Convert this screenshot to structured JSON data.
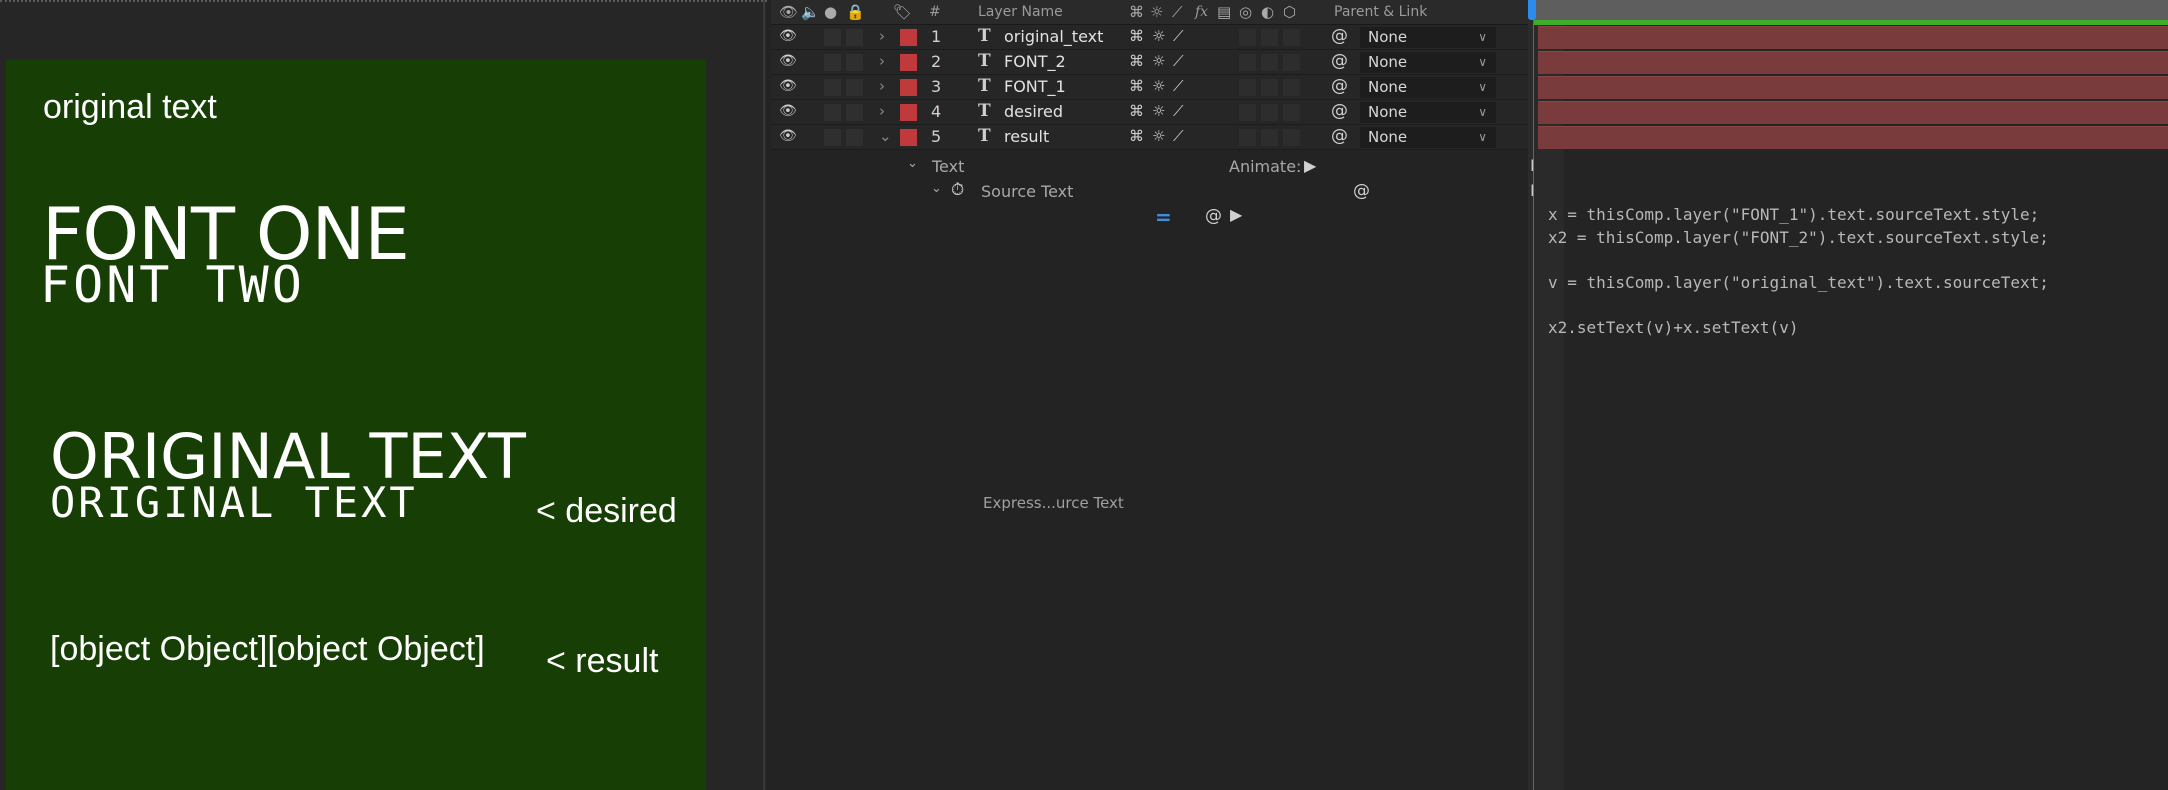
{
  "comp": {
    "original_text": "original text",
    "font_one": "FONT ONE",
    "font_two": "FONT TWO",
    "original_big": "ORIGINAL TEXT",
    "original_mono": "ORIGINAL TEXT",
    "desired_label": "< desired",
    "result_text": "[object Object][object Object]",
    "result_label": "< result",
    "bg_color": "#173e05"
  },
  "layers_header": {
    "num": "#",
    "layer_name": "Layer Name",
    "fx": "fx",
    "parent_link": "Parent & Link"
  },
  "layers": [
    {
      "num": "1",
      "name": "original_text",
      "parent": "None"
    },
    {
      "num": "2",
      "name": "FONT_2",
      "parent": "None"
    },
    {
      "num": "3",
      "name": "FONT_1",
      "parent": "None"
    },
    {
      "num": "4",
      "name": "desired",
      "parent": "None"
    },
    {
      "num": "5",
      "name": "result",
      "parent": "None"
    }
  ],
  "properties": {
    "text_group": "Text",
    "animate": "Animate:",
    "source_text": "Source Text",
    "expression_hint": "Express...urce Text"
  },
  "expression": {
    "lines": [
      "x = thisComp.layer(\"FONT_1\").text.sourceText.style;",
      "x2 = thisComp.layer(\"FONT_2\").text.sourceText.style;",
      "",
      "v = thisComp.layer(\"original_text\").text.sourceText;",
      "",
      "x2.setText(v)+x.setText(v)"
    ]
  },
  "colors": {
    "label_red": "#c0393b",
    "timeline_bar": "#7a3b3d",
    "work_area": "#3fae2a",
    "cti_blue": "#2d8ceb"
  }
}
